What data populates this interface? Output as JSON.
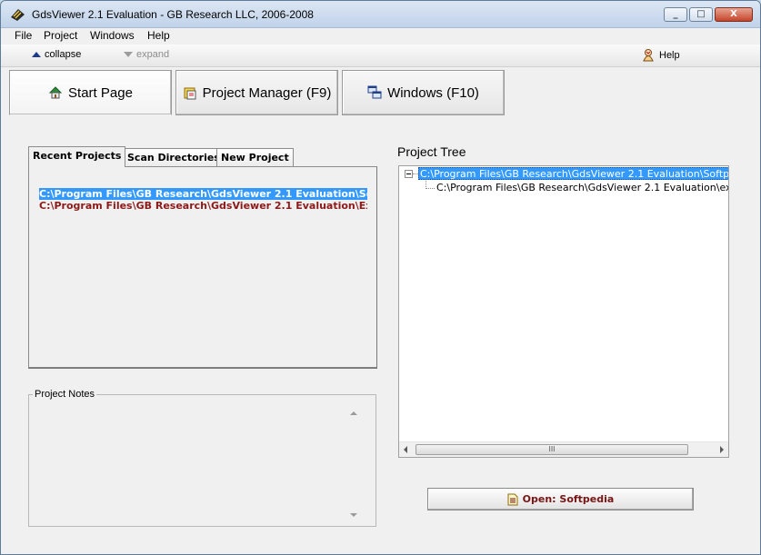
{
  "window": {
    "title": "GdsViewer 2.1 Evaluation - GB Research LLC, 2006-2008",
    "controls": {
      "minimize": "_",
      "maximize": "□",
      "close": "X"
    }
  },
  "menu": {
    "items": [
      "File",
      "Project",
      "Windows",
      "Help"
    ]
  },
  "toolbar": {
    "collapse_label": "collapse",
    "expand_label": "expand",
    "help_label": "Help"
  },
  "nav": {
    "start_page": "Start Page",
    "project_manager": "Project Manager (F9)",
    "windows": "Windows (F10)"
  },
  "left_panel": {
    "tabs": [
      "Recent Projects",
      "Scan Directories",
      "New Project"
    ],
    "recent_projects": [
      "C:\\Program Files\\GB Research\\GdsViewer 2.1 Evaluation\\Softpedia.gvp",
      "C:\\Program Files\\GB Research\\GdsViewer 2.1 Evaluation\\Example.gvp"
    ],
    "notes_label": "Project Notes"
  },
  "project_tree": {
    "heading": "Project Tree",
    "root": "C:\\Program Files\\GB Research\\GdsViewer 2.1 Evaluation\\Softpedia.gvp",
    "child": "C:\\Program Files\\GB Research\\GdsViewer 2.1 Evaluation\\example.gds",
    "scroll_grip": "III"
  },
  "open_button": {
    "label": "Open: Softpedia"
  },
  "colors": {
    "selection": "#3399ff",
    "accent_text": "#8b1a1a",
    "window_bg": "#f0f0f0"
  }
}
